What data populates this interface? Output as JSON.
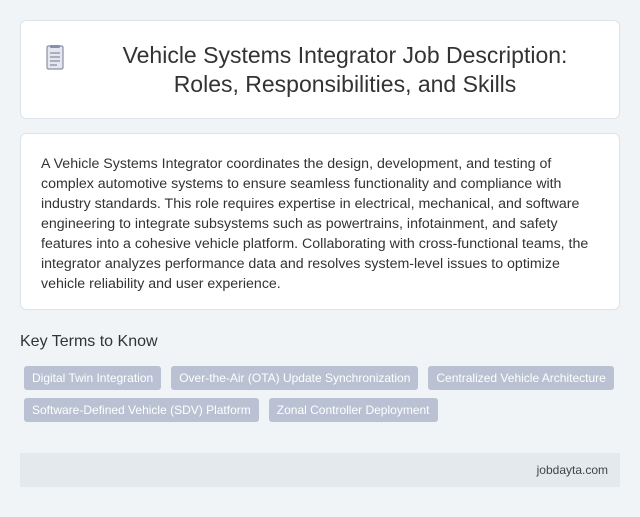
{
  "header": {
    "icon": "document-icon",
    "title": "Vehicle Systems Integrator Job Description: Roles, Responsibilities, and Skills"
  },
  "description": "A Vehicle Systems Integrator coordinates the design, development, and testing of complex automotive systems to ensure seamless functionality and compliance with industry standards. This role requires expertise in electrical, mechanical, and software engineering to integrate subsystems such as powertrains, infotainment, and safety features into a cohesive vehicle platform. Collaborating with cross-functional teams, the integrator analyzes performance data and resolves system-level issues to optimize vehicle reliability and user experience.",
  "key_terms": {
    "heading": "Key Terms to Know",
    "tags": [
      "Digital Twin Integration",
      "Over-the-Air (OTA) Update Synchronization",
      "Centralized Vehicle Architecture",
      "Software-Defined Vehicle (SDV) Platform",
      "Zonal Controller Deployment"
    ]
  },
  "footer": {
    "source": "jobdayta.com"
  },
  "colors": {
    "background": "#f0f4f7",
    "card": "#ffffff",
    "tag": "#b9c1d2",
    "footer": "#e3e9ec"
  }
}
